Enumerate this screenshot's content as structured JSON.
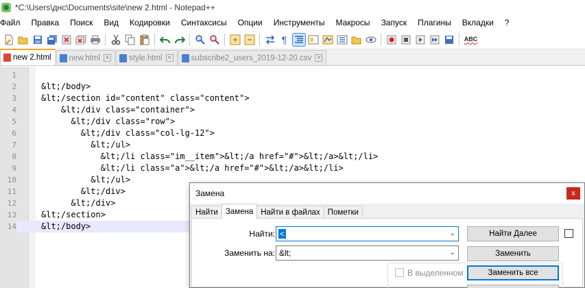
{
  "window": {
    "title": "*C:\\Users\\днс\\Documents\\site\\new 2.html - Notepad++"
  },
  "menu": [
    "Файл",
    "Правка",
    "Поиск",
    "Вид",
    "Кодировки",
    "Синтаксисы",
    "Опции",
    "Инструменты",
    "Макросы",
    "Запуск",
    "Плагины",
    "Вкладки",
    "?"
  ],
  "toolbar": {
    "spellcheck_label": "ABC"
  },
  "tabs": [
    {
      "label": "new 2.html",
      "active": true,
      "icon": "red-file-icon"
    },
    {
      "label": "new.html",
      "active": false,
      "icon": "blue-file-icon"
    },
    {
      "label": "style.html",
      "active": false,
      "icon": "blue-file-icon"
    },
    {
      "label": "subscribe2_users_2019-12-20.csv",
      "active": false,
      "icon": "blue-file-icon"
    }
  ],
  "editor": {
    "current_line": 14,
    "lines": [
      {
        "num": "1",
        "text": ""
      },
      {
        "num": "2",
        "text": "&lt;/body>"
      },
      {
        "num": "3",
        "text": "&lt;/section id=\"content\" class=\"content\">"
      },
      {
        "num": "4",
        "text": "    &lt;/div class=\"container\">"
      },
      {
        "num": "5",
        "text": "      &lt;/div class=\"row\">"
      },
      {
        "num": "6",
        "text": "        &lt;/div class=\"col-lg-12\">"
      },
      {
        "num": "7",
        "text": "          &lt;/ul>"
      },
      {
        "num": "8",
        "text": "            &lt;/li class=\"im__item\">&lt;/a href=\"#\">&lt;/a>&lt;/li>"
      },
      {
        "num": "9",
        "text": "            &lt;/li class=\"a\">&lt;/a href=\"#\">&lt;/a>&lt;/li>"
      },
      {
        "num": "10",
        "text": "          &lt;/ul>"
      },
      {
        "num": "11",
        "text": "        &lt;/div>"
      },
      {
        "num": "12",
        "text": "      &lt;/div>"
      },
      {
        "num": "13",
        "text": "&lt;/section>"
      },
      {
        "num": "14",
        "text": "&lt;/body>"
      }
    ]
  },
  "dialog": {
    "title": "Замена",
    "close_label": "x",
    "tabs": [
      "Найти",
      "Замена",
      "Найти в файлах",
      "Пометки"
    ],
    "active_tab": "Замена",
    "find_label": "Найти:",
    "find_value": "<",
    "replace_label": "Заменить на:",
    "replace_value": "&lt;",
    "find_next_button": "Найти Далее",
    "replace_button": "Заменить",
    "replace_all_button": "Заменить все",
    "in_selection_label": "В выделенном"
  }
}
